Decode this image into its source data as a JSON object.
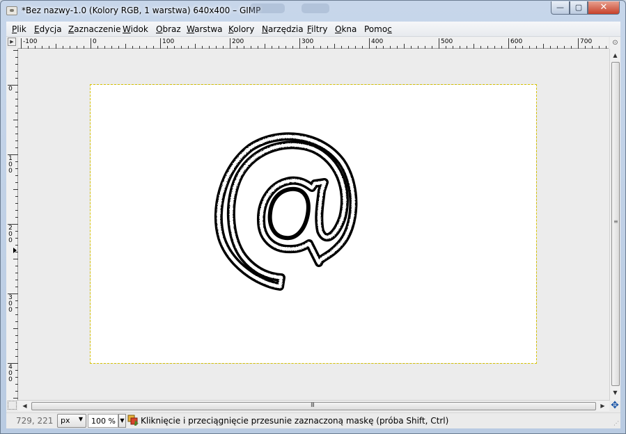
{
  "window": {
    "title": "*Bez nazwy-1.0 (Kolory RGB, 1 warstwa) 640x400 – GIMP",
    "minimize_label": "—",
    "maximize_label": "▢",
    "close_label": "✕"
  },
  "menu": {
    "items": [
      {
        "u": "P",
        "rest": "lik"
      },
      {
        "u": "E",
        "rest": "dycja"
      },
      {
        "u": "Z",
        "rest": "aznaczenie"
      },
      {
        "u": "W",
        "rest": "idok"
      },
      {
        "u": "O",
        "rest": "braz"
      },
      {
        "u": "W",
        "rest": "arstwa"
      },
      {
        "u": "K",
        "rest": "olory"
      },
      {
        "u": "N",
        "rest": "arzędzia"
      },
      {
        "u": "F",
        "rest": "iltry"
      },
      {
        "u": "O",
        "rest": "kna"
      },
      {
        "pre": "Pomo",
        "u": "c",
        "rest": ""
      }
    ]
  },
  "rulers": {
    "horizontal_ticks": [
      "-100",
      "0",
      "100",
      "200",
      "300",
      "400",
      "500",
      "600",
      "700"
    ],
    "vertical_ticks": [
      [
        "0"
      ],
      [
        "1",
        "0",
        "0"
      ],
      [
        "2",
        "0",
        "0"
      ],
      [
        "3",
        "0",
        "0"
      ],
      [
        "4",
        "0",
        "0"
      ]
    ]
  },
  "canvas": {
    "image_size": "640x400",
    "drawing": "@-shaped selection mask outline"
  },
  "icons": {
    "app": "gimp-document-icon",
    "navigate": "move-cross-icon",
    "tool": "move-tool-icon",
    "quickmask": "quickmask-icon"
  },
  "statusbar": {
    "pointer_coords": "729, 221",
    "unit": "px",
    "zoom": "100 %",
    "message": "Kliknięcie i przeciągnięcie przesunie zaznaczoną maskę (próba Shift, Ctrl)"
  },
  "colors": {
    "selection_dash": "#d8c400",
    "outline": "#000000",
    "canvas_bg": "#ffffff",
    "workspace_bg": "#ececec"
  }
}
